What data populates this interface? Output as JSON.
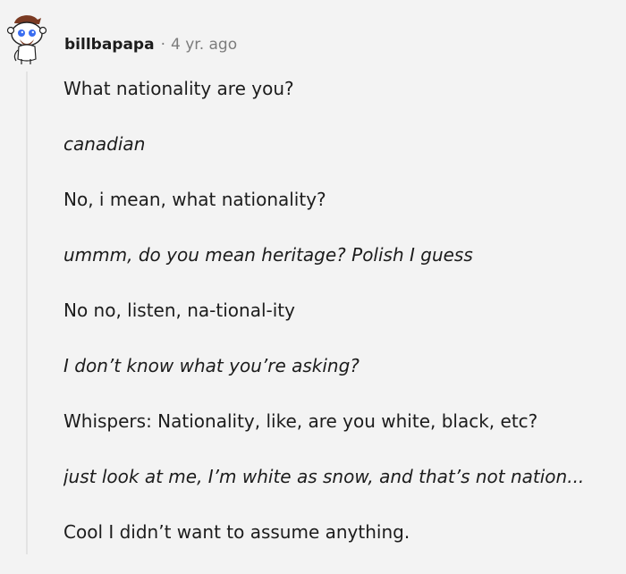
{
  "comment": {
    "author": "billbapapa",
    "separator": "·",
    "timestamp": "4 yr. ago",
    "avatar_icon": "reddit-snoo-avatar-icon",
    "lines": [
      {
        "text": "What nationality are you?",
        "italic": false
      },
      {
        "text": "canadian",
        "italic": true
      },
      {
        "text": "No, i mean, what nationality?",
        "italic": false
      },
      {
        "text": "ummm, do you mean heritage? Polish I guess",
        "italic": true
      },
      {
        "text": "No no, listen, na-tional-ity",
        "italic": false
      },
      {
        "text": "I don’t know what you’re asking?",
        "italic": true
      },
      {
        "text": "Whispers: Nationality, like, are you white, black, etc?",
        "italic": false
      },
      {
        "text": "just look at me, I’m white as snow, and that’s not nation...",
        "italic": true
      },
      {
        "text": "Cool I didn’t want to assume anything.",
        "italic": false
      }
    ]
  },
  "colors": {
    "background": "#f3f3f3",
    "text": "#1c1c1c",
    "muted": "#7c7c7c",
    "avatar_eye": "#3a6df0",
    "avatar_hair": "#7a3a22"
  }
}
